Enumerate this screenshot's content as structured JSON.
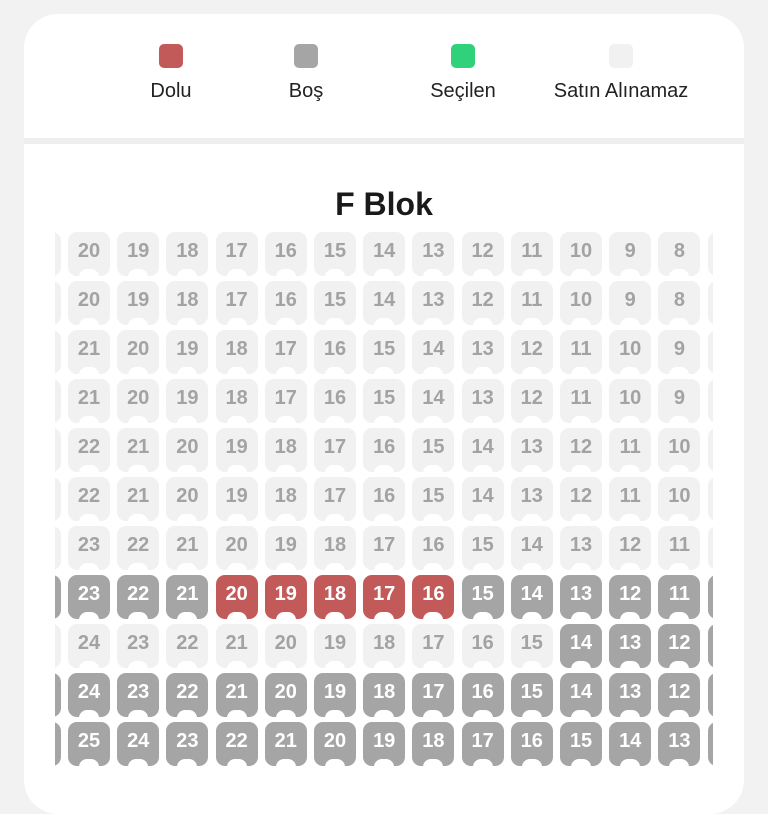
{
  "legend": {
    "items": [
      {
        "label": "Dolu",
        "color": "#c35a5a",
        "status": "full"
      },
      {
        "label": "Boş",
        "color": "#a5a5a5",
        "status": "empty"
      },
      {
        "label": "Seçilen",
        "color": "#2fd17a",
        "status": "selected"
      },
      {
        "label": "Satın Alınamaz",
        "color": "#f1f1f1",
        "status": "unavailable"
      }
    ]
  },
  "block": {
    "title": "F Blok"
  },
  "rows": [
    {
      "seats": [
        {
          "n": "20",
          "s": "na"
        },
        {
          "n": "19",
          "s": "na"
        },
        {
          "n": "18",
          "s": "na"
        },
        {
          "n": "17",
          "s": "na"
        },
        {
          "n": "16",
          "s": "na"
        },
        {
          "n": "15",
          "s": "na"
        },
        {
          "n": "14",
          "s": "na"
        },
        {
          "n": "13",
          "s": "na"
        },
        {
          "n": "12",
          "s": "na"
        },
        {
          "n": "11",
          "s": "na"
        },
        {
          "n": "10",
          "s": "na"
        },
        {
          "n": "9",
          "s": "na"
        },
        {
          "n": "8",
          "s": "na"
        }
      ]
    },
    {
      "seats": [
        {
          "n": "20",
          "s": "na"
        },
        {
          "n": "19",
          "s": "na"
        },
        {
          "n": "18",
          "s": "na"
        },
        {
          "n": "17",
          "s": "na"
        },
        {
          "n": "16",
          "s": "na"
        },
        {
          "n": "15",
          "s": "na"
        },
        {
          "n": "14",
          "s": "na"
        },
        {
          "n": "13",
          "s": "na"
        },
        {
          "n": "12",
          "s": "na"
        },
        {
          "n": "11",
          "s": "na"
        },
        {
          "n": "10",
          "s": "na"
        },
        {
          "n": "9",
          "s": "na"
        },
        {
          "n": "8",
          "s": "na"
        }
      ]
    },
    {
      "seats": [
        {
          "n": "21",
          "s": "na"
        },
        {
          "n": "20",
          "s": "na"
        },
        {
          "n": "19",
          "s": "na"
        },
        {
          "n": "18",
          "s": "na"
        },
        {
          "n": "17",
          "s": "na"
        },
        {
          "n": "16",
          "s": "na"
        },
        {
          "n": "15",
          "s": "na"
        },
        {
          "n": "14",
          "s": "na"
        },
        {
          "n": "13",
          "s": "na"
        },
        {
          "n": "12",
          "s": "na"
        },
        {
          "n": "11",
          "s": "na"
        },
        {
          "n": "10",
          "s": "na"
        },
        {
          "n": "9",
          "s": "na"
        }
      ]
    },
    {
      "seats": [
        {
          "n": "21",
          "s": "na"
        },
        {
          "n": "20",
          "s": "na"
        },
        {
          "n": "19",
          "s": "na"
        },
        {
          "n": "18",
          "s": "na"
        },
        {
          "n": "17",
          "s": "na"
        },
        {
          "n": "16",
          "s": "na"
        },
        {
          "n": "15",
          "s": "na"
        },
        {
          "n": "14",
          "s": "na"
        },
        {
          "n": "13",
          "s": "na"
        },
        {
          "n": "12",
          "s": "na"
        },
        {
          "n": "11",
          "s": "na"
        },
        {
          "n": "10",
          "s": "na"
        },
        {
          "n": "9",
          "s": "na"
        }
      ]
    },
    {
      "seats": [
        {
          "n": "22",
          "s": "na"
        },
        {
          "n": "21",
          "s": "na"
        },
        {
          "n": "20",
          "s": "na"
        },
        {
          "n": "19",
          "s": "na"
        },
        {
          "n": "18",
          "s": "na"
        },
        {
          "n": "17",
          "s": "na"
        },
        {
          "n": "16",
          "s": "na"
        },
        {
          "n": "15",
          "s": "na"
        },
        {
          "n": "14",
          "s": "na"
        },
        {
          "n": "13",
          "s": "na"
        },
        {
          "n": "12",
          "s": "na"
        },
        {
          "n": "11",
          "s": "na"
        },
        {
          "n": "10",
          "s": "na"
        }
      ]
    },
    {
      "seats": [
        {
          "n": "22",
          "s": "na"
        },
        {
          "n": "21",
          "s": "na"
        },
        {
          "n": "20",
          "s": "na"
        },
        {
          "n": "19",
          "s": "na"
        },
        {
          "n": "18",
          "s": "na"
        },
        {
          "n": "17",
          "s": "na"
        },
        {
          "n": "16",
          "s": "na"
        },
        {
          "n": "15",
          "s": "na"
        },
        {
          "n": "14",
          "s": "na"
        },
        {
          "n": "13",
          "s": "na"
        },
        {
          "n": "12",
          "s": "na"
        },
        {
          "n": "11",
          "s": "na"
        },
        {
          "n": "10",
          "s": "na"
        }
      ]
    },
    {
      "seats": [
        {
          "n": "23",
          "s": "na"
        },
        {
          "n": "22",
          "s": "na"
        },
        {
          "n": "21",
          "s": "na"
        },
        {
          "n": "20",
          "s": "na"
        },
        {
          "n": "19",
          "s": "na"
        },
        {
          "n": "18",
          "s": "na"
        },
        {
          "n": "17",
          "s": "na"
        },
        {
          "n": "16",
          "s": "na"
        },
        {
          "n": "15",
          "s": "na"
        },
        {
          "n": "14",
          "s": "na"
        },
        {
          "n": "13",
          "s": "na"
        },
        {
          "n": "12",
          "s": "na"
        },
        {
          "n": "11",
          "s": "na"
        }
      ]
    },
    {
      "seats": [
        {
          "n": "23",
          "s": "empty"
        },
        {
          "n": "22",
          "s": "empty"
        },
        {
          "n": "21",
          "s": "empty"
        },
        {
          "n": "20",
          "s": "full"
        },
        {
          "n": "19",
          "s": "full"
        },
        {
          "n": "18",
          "s": "full"
        },
        {
          "n": "17",
          "s": "full"
        },
        {
          "n": "16",
          "s": "full"
        },
        {
          "n": "15",
          "s": "empty"
        },
        {
          "n": "14",
          "s": "empty"
        },
        {
          "n": "13",
          "s": "empty"
        },
        {
          "n": "12",
          "s": "empty"
        },
        {
          "n": "11",
          "s": "empty"
        }
      ]
    },
    {
      "seats": [
        {
          "n": "24",
          "s": "na"
        },
        {
          "n": "23",
          "s": "na"
        },
        {
          "n": "22",
          "s": "na"
        },
        {
          "n": "21",
          "s": "na"
        },
        {
          "n": "20",
          "s": "na"
        },
        {
          "n": "19",
          "s": "na"
        },
        {
          "n": "18",
          "s": "na"
        },
        {
          "n": "17",
          "s": "na"
        },
        {
          "n": "16",
          "s": "na"
        },
        {
          "n": "15",
          "s": "na"
        },
        {
          "n": "14",
          "s": "empty"
        },
        {
          "n": "13",
          "s": "empty"
        },
        {
          "n": "12",
          "s": "empty"
        }
      ]
    },
    {
      "seats": [
        {
          "n": "24",
          "s": "empty"
        },
        {
          "n": "23",
          "s": "empty"
        },
        {
          "n": "22",
          "s": "empty"
        },
        {
          "n": "21",
          "s": "empty"
        },
        {
          "n": "20",
          "s": "empty"
        },
        {
          "n": "19",
          "s": "empty"
        },
        {
          "n": "18",
          "s": "empty"
        },
        {
          "n": "17",
          "s": "empty"
        },
        {
          "n": "16",
          "s": "empty"
        },
        {
          "n": "15",
          "s": "empty"
        },
        {
          "n": "14",
          "s": "empty"
        },
        {
          "n": "13",
          "s": "empty"
        },
        {
          "n": "12",
          "s": "empty"
        }
      ]
    },
    {
      "seats": [
        {
          "n": "25",
          "s": "empty"
        },
        {
          "n": "24",
          "s": "empty"
        },
        {
          "n": "23",
          "s": "empty"
        },
        {
          "n": "22",
          "s": "empty"
        },
        {
          "n": "21",
          "s": "empty"
        },
        {
          "n": "20",
          "s": "empty"
        },
        {
          "n": "19",
          "s": "empty"
        },
        {
          "n": "18",
          "s": "empty"
        },
        {
          "n": "17",
          "s": "empty"
        },
        {
          "n": "16",
          "s": "empty"
        },
        {
          "n": "15",
          "s": "empty"
        },
        {
          "n": "14",
          "s": "empty"
        },
        {
          "n": "13",
          "s": "empty"
        }
      ]
    }
  ]
}
